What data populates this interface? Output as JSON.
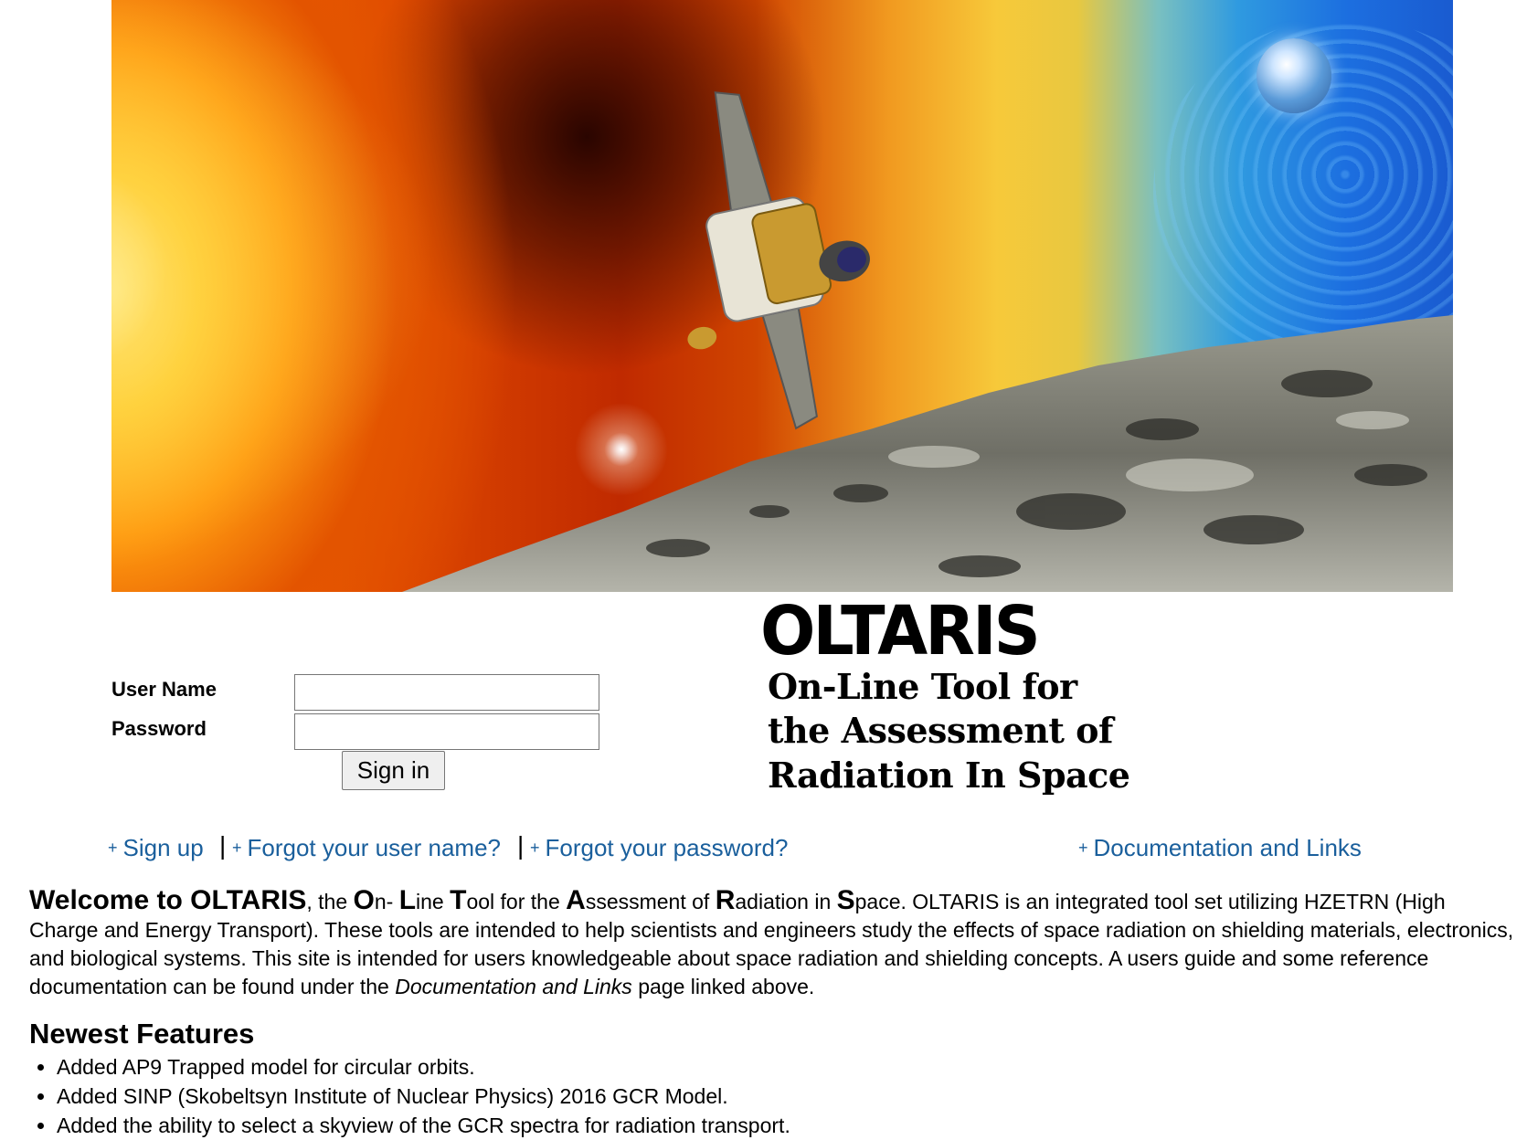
{
  "logo": {
    "title": "OLTARIS",
    "subtitle_lines": [
      "On-Line Tool for",
      "the Assessment of",
      "Radiation In Space"
    ]
  },
  "login": {
    "username_label": "User Name",
    "password_label": "Password",
    "username_value": "",
    "password_value": "",
    "signin_label": "Sign in"
  },
  "nav": {
    "plus": "+",
    "separator": "|",
    "signup": "Sign up",
    "forgot_user": "Forgot your user name?",
    "forgot_pass": "Forgot your password?",
    "docs": "Documentation and Links",
    "link_color": "#1a5f9c"
  },
  "welcome": {
    "lead": "Welcome to OLTARIS",
    "t1": ", the ",
    "c1": "O",
    "t2": "n- ",
    "c2": "L",
    "t3": "ine ",
    "c3": "T",
    "t4": "ool for the ",
    "c4": "A",
    "t5": "ssessment of ",
    "c5": "R",
    "t6": "adiation in ",
    "c6": "S",
    "t7": "pace. OLTARIS is an integrated tool set utilizing HZETRN (High Charge and Energy Transport). These tools are intended to help scientists and engineers study the effects of space radiation on shielding materials, electronics, and biological systems. This site is intended for users knowledgeable about space radiation and shielding concepts. A users guide and some reference documentation can be found under the ",
    "em": "Documentation and Links",
    "t8": " page linked above."
  },
  "features": {
    "heading": "Newest Features",
    "items": [
      "Added AP9 Trapped model for circular orbits.",
      "Added SINP (Skobeltsyn Institute of Nuclear Physics) 2016 GCR Model.",
      "Added the ability to select a skyview of the GCR spectra for radiation transport."
    ]
  }
}
